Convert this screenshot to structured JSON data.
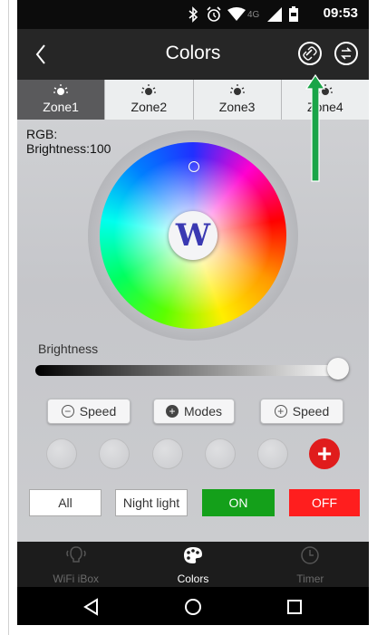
{
  "status_bar": {
    "time": "09:53",
    "network": "4G",
    "icons": [
      "bluetooth-icon",
      "alarm-icon",
      "wifi-icon",
      "signal-icon",
      "battery-icon"
    ]
  },
  "header": {
    "title": "Colors",
    "back_icon": "chevron-left-icon",
    "link_icon": "link-icon",
    "sync_icon": "sync-icon"
  },
  "zones": [
    {
      "label": "Zone1",
      "active": true
    },
    {
      "label": "Zone2",
      "active": false
    },
    {
      "label": "Zone3",
      "active": false
    },
    {
      "label": "Zone4",
      "active": false
    }
  ],
  "info": {
    "rgb": "RGB:",
    "brightness": "Brightness:100"
  },
  "wheel": {
    "white_button": "W"
  },
  "brightness_slider": {
    "label": "Brightness",
    "value_percent": 100
  },
  "controls": {
    "speed_down": "Speed",
    "modes": "Modes",
    "speed_up": "Speed"
  },
  "presets": {
    "add_label": "+"
  },
  "actions": {
    "all": "All",
    "night_light": "Night light",
    "on": "ON",
    "off": "OFF"
  },
  "tabbar": [
    {
      "label": "WiFi iBox",
      "active": false
    },
    {
      "label": "Colors",
      "active": true
    },
    {
      "label": "Timer",
      "active": false
    }
  ],
  "colors": {
    "on": "#14a01a",
    "off": "#ff1e1e",
    "accent_arrow": "#1aa548"
  }
}
